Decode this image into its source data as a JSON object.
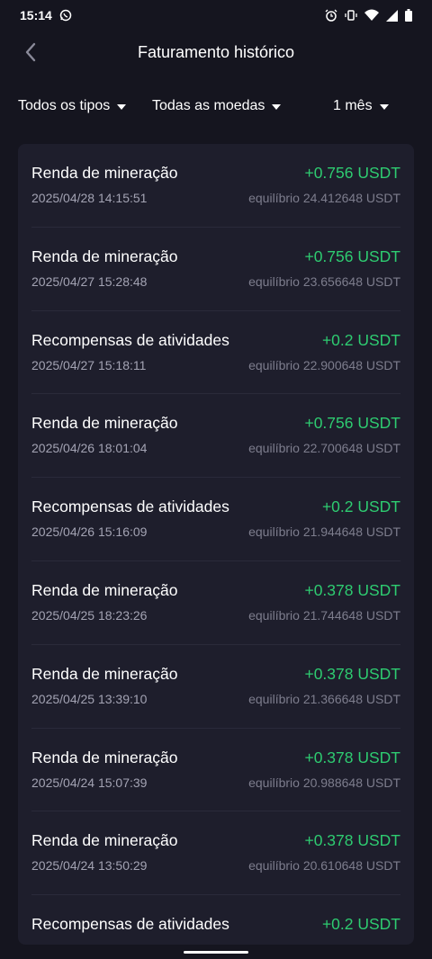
{
  "status_bar": {
    "time": "15:14"
  },
  "header": {
    "title": "Faturamento histórico"
  },
  "filters": {
    "type": "Todos os tipos",
    "currency": "Todas as moedas",
    "period": "1 mês"
  },
  "colors": {
    "background": "#15151f",
    "card": "#1e1e2c",
    "positive": "#2ecc71"
  },
  "transactions": [
    {
      "title": "Renda de mineração",
      "amount": "+0.756 USDT",
      "date": "2025/04/28 14:15:51",
      "balance": "equilíbrio 24.412648 USDT"
    },
    {
      "title": "Renda de mineração",
      "amount": "+0.756 USDT",
      "date": "2025/04/27 15:28:48",
      "balance": "equilíbrio 23.656648 USDT"
    },
    {
      "title": "Recompensas de atividades",
      "amount": "+0.2 USDT",
      "date": "2025/04/27 15:18:11",
      "balance": "equilíbrio 22.900648 USDT"
    },
    {
      "title": "Renda de mineração",
      "amount": "+0.756 USDT",
      "date": "2025/04/26 18:01:04",
      "balance": "equilíbrio 22.700648 USDT"
    },
    {
      "title": "Recompensas de atividades",
      "amount": "+0.2 USDT",
      "date": "2025/04/26 15:16:09",
      "balance": "equilíbrio 21.944648 USDT"
    },
    {
      "title": "Renda de mineração",
      "amount": "+0.378 USDT",
      "date": "2025/04/25 18:23:26",
      "balance": "equilíbrio 21.744648 USDT"
    },
    {
      "title": "Renda de mineração",
      "amount": "+0.378 USDT",
      "date": "2025/04/25 13:39:10",
      "balance": "equilíbrio 21.366648 USDT"
    },
    {
      "title": "Renda de mineração",
      "amount": "+0.378 USDT",
      "date": "2025/04/24 15:07:39",
      "balance": "equilíbrio 20.988648 USDT"
    },
    {
      "title": "Renda de mineração",
      "amount": "+0.378 USDT",
      "date": "2025/04/24 13:50:29",
      "balance": "equilíbrio 20.610648 USDT"
    },
    {
      "title": "Recompensas de atividades",
      "amount": "+0.2 USDT",
      "date": "",
      "balance": ""
    }
  ]
}
